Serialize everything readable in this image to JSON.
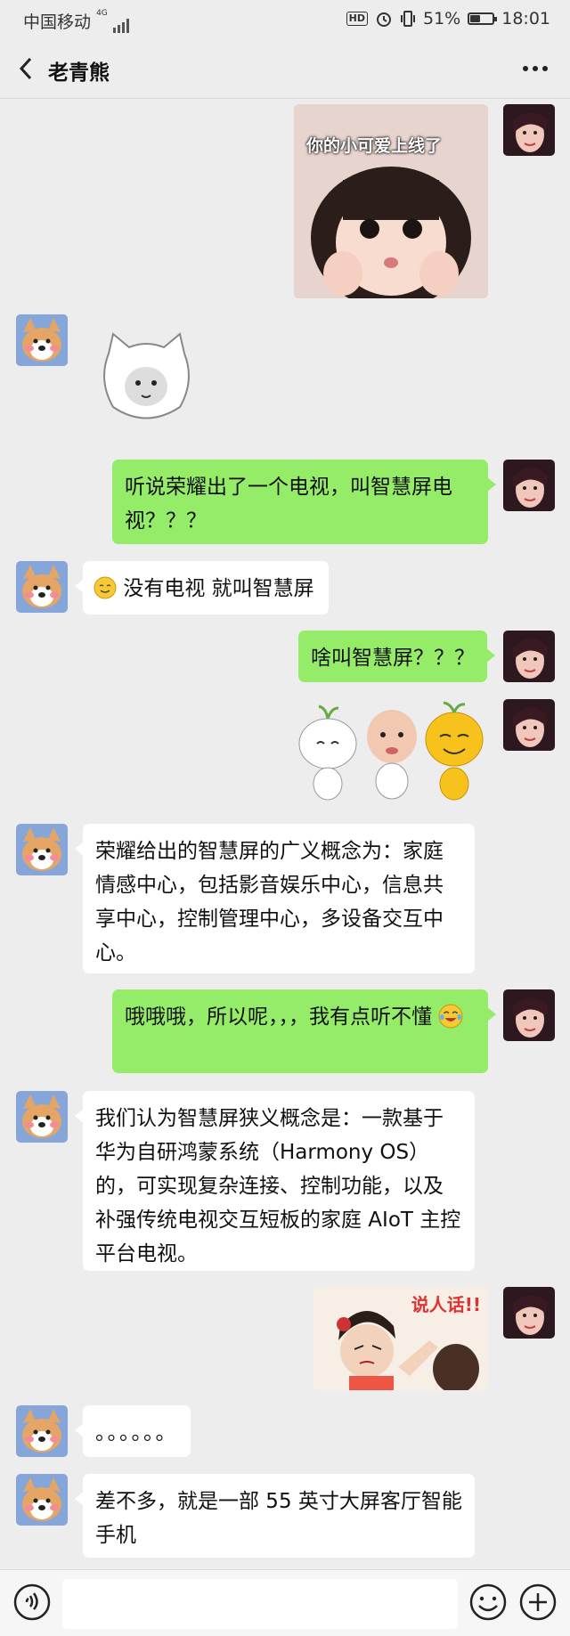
{
  "status": {
    "carrier": "中国移动",
    "network": "4G",
    "hd": "HD",
    "battery_pct": "51%",
    "battery_level": 0.51,
    "time": "18:01"
  },
  "header": {
    "title": "老青熊"
  },
  "messages": {
    "sticker1_caption": "你的小可爱上线了",
    "m1": "听说荣耀出了一个电视，叫智慧屏电视？？？",
    "m2": "没有电视 就叫智慧屏",
    "m3": "啥叫智慧屏？？？",
    "m4": "荣耀给出的智慧屏的广义概念为：家庭情感中心，包括影音娱乐中心，信息共享中心，控制管理中心，多设备交互中心。",
    "m5": "哦哦哦，所以呢，，，我有点听不懂",
    "m6": "我们认为智慧屏狭义概念是：一款基于华为自研鸿蒙系统（Harmony OS）的，可实现复杂连接、控制功能，以及补强传统电视交互短板的家庭 AIoT 主控平台电视。",
    "sticker_caption2": "说人话!!",
    "m7": "。。。。。。",
    "m8": "差不多，就是一部 55 英寸大屏客厅智能手机"
  },
  "icons": {
    "back": "chevron-left-icon",
    "more": "more-dots-icon",
    "voice": "voice-icon",
    "emoji": "emoji-icon",
    "add": "plus-icon"
  }
}
